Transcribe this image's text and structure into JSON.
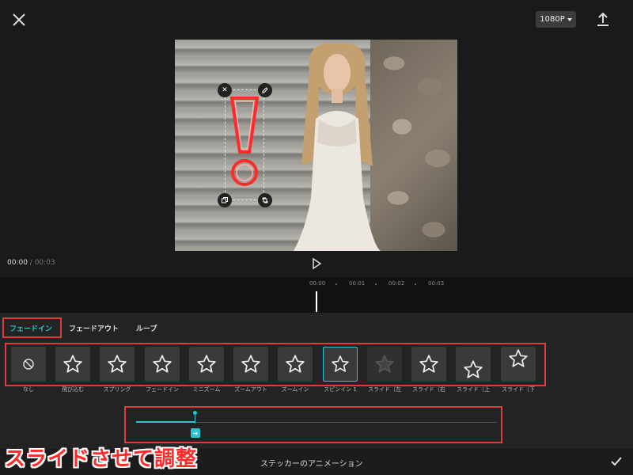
{
  "header": {
    "resolution": "1080P"
  },
  "player": {
    "current_time": "00:00",
    "separator": " / ",
    "total_time": "00:03"
  },
  "timeline": {
    "ticks": [
      "00:00",
      "00:01",
      "00:02",
      "00:03"
    ]
  },
  "tabs": [
    {
      "label": "フェードイン",
      "active": true
    },
    {
      "label": "フェードアウト",
      "active": false
    },
    {
      "label": "ループ",
      "active": false
    }
  ],
  "animations": [
    {
      "label": "なし",
      "icon": "none-icon"
    },
    {
      "label": "飛び込む",
      "icon": "star-icon"
    },
    {
      "label": "スプリング",
      "icon": "star-icon"
    },
    {
      "label": "フェードイン",
      "icon": "star-icon"
    },
    {
      "label": "ミニズーム",
      "icon": "star-icon"
    },
    {
      "label": "ズームアウト",
      "icon": "star-icon"
    },
    {
      "label": "ズームイン",
      "icon": "star-icon"
    },
    {
      "label": "スピンイン 1",
      "icon": "star-icon",
      "selected": true
    },
    {
      "label": "スライド（左",
      "icon": "star-icon",
      "dim": true
    },
    {
      "label": "スライド（右",
      "icon": "star-icon"
    },
    {
      "label": "スライド（上",
      "icon": "star-icon"
    },
    {
      "label": "スライド（下",
      "icon": "star-icon"
    }
  ],
  "slider": {
    "value": 0.16
  },
  "bottom": {
    "title": "ステッカーのアニメーション"
  },
  "caption": "スライドさせて調整",
  "colors": {
    "accent": "#2ec4cf",
    "highlight": "#e23a3a",
    "sticker": "#ff2a2a"
  }
}
